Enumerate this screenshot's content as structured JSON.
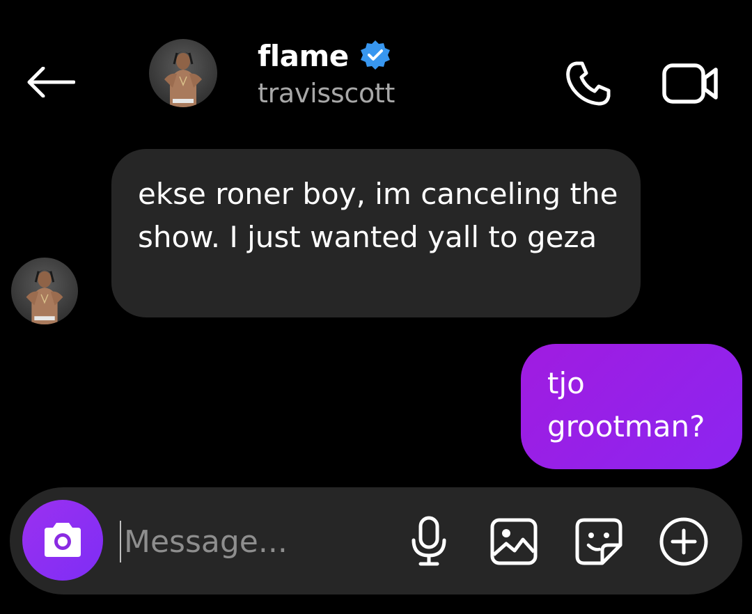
{
  "header": {
    "contact_name": "flame",
    "contact_handle": "travisscott",
    "back_icon": "arrow-left-icon",
    "verified_icon": "verified-badge-icon",
    "call_icon": "phone-icon",
    "video_icon": "video-camera-icon"
  },
  "messages": [
    {
      "direction": "incoming",
      "text": "ekse roner boy, im canceling the show. I just wanted yall to geza"
    },
    {
      "direction": "outgoing",
      "text": "tjo grootman?"
    }
  ],
  "composer": {
    "placeholder": "Message...",
    "value": "",
    "camera_icon": "camera-icon",
    "mic_icon": "microphone-icon",
    "gallery_icon": "image-icon",
    "sticker_icon": "sticker-icon",
    "plus_icon": "plus-circle-icon"
  },
  "colors": {
    "background": "#000000",
    "bubble_incoming": "#262626",
    "bubble_outgoing": "#9b1fe8",
    "verified": "#3897f0",
    "camera_button": "#8a2be2",
    "secondary_text": "#a8a8a8"
  }
}
